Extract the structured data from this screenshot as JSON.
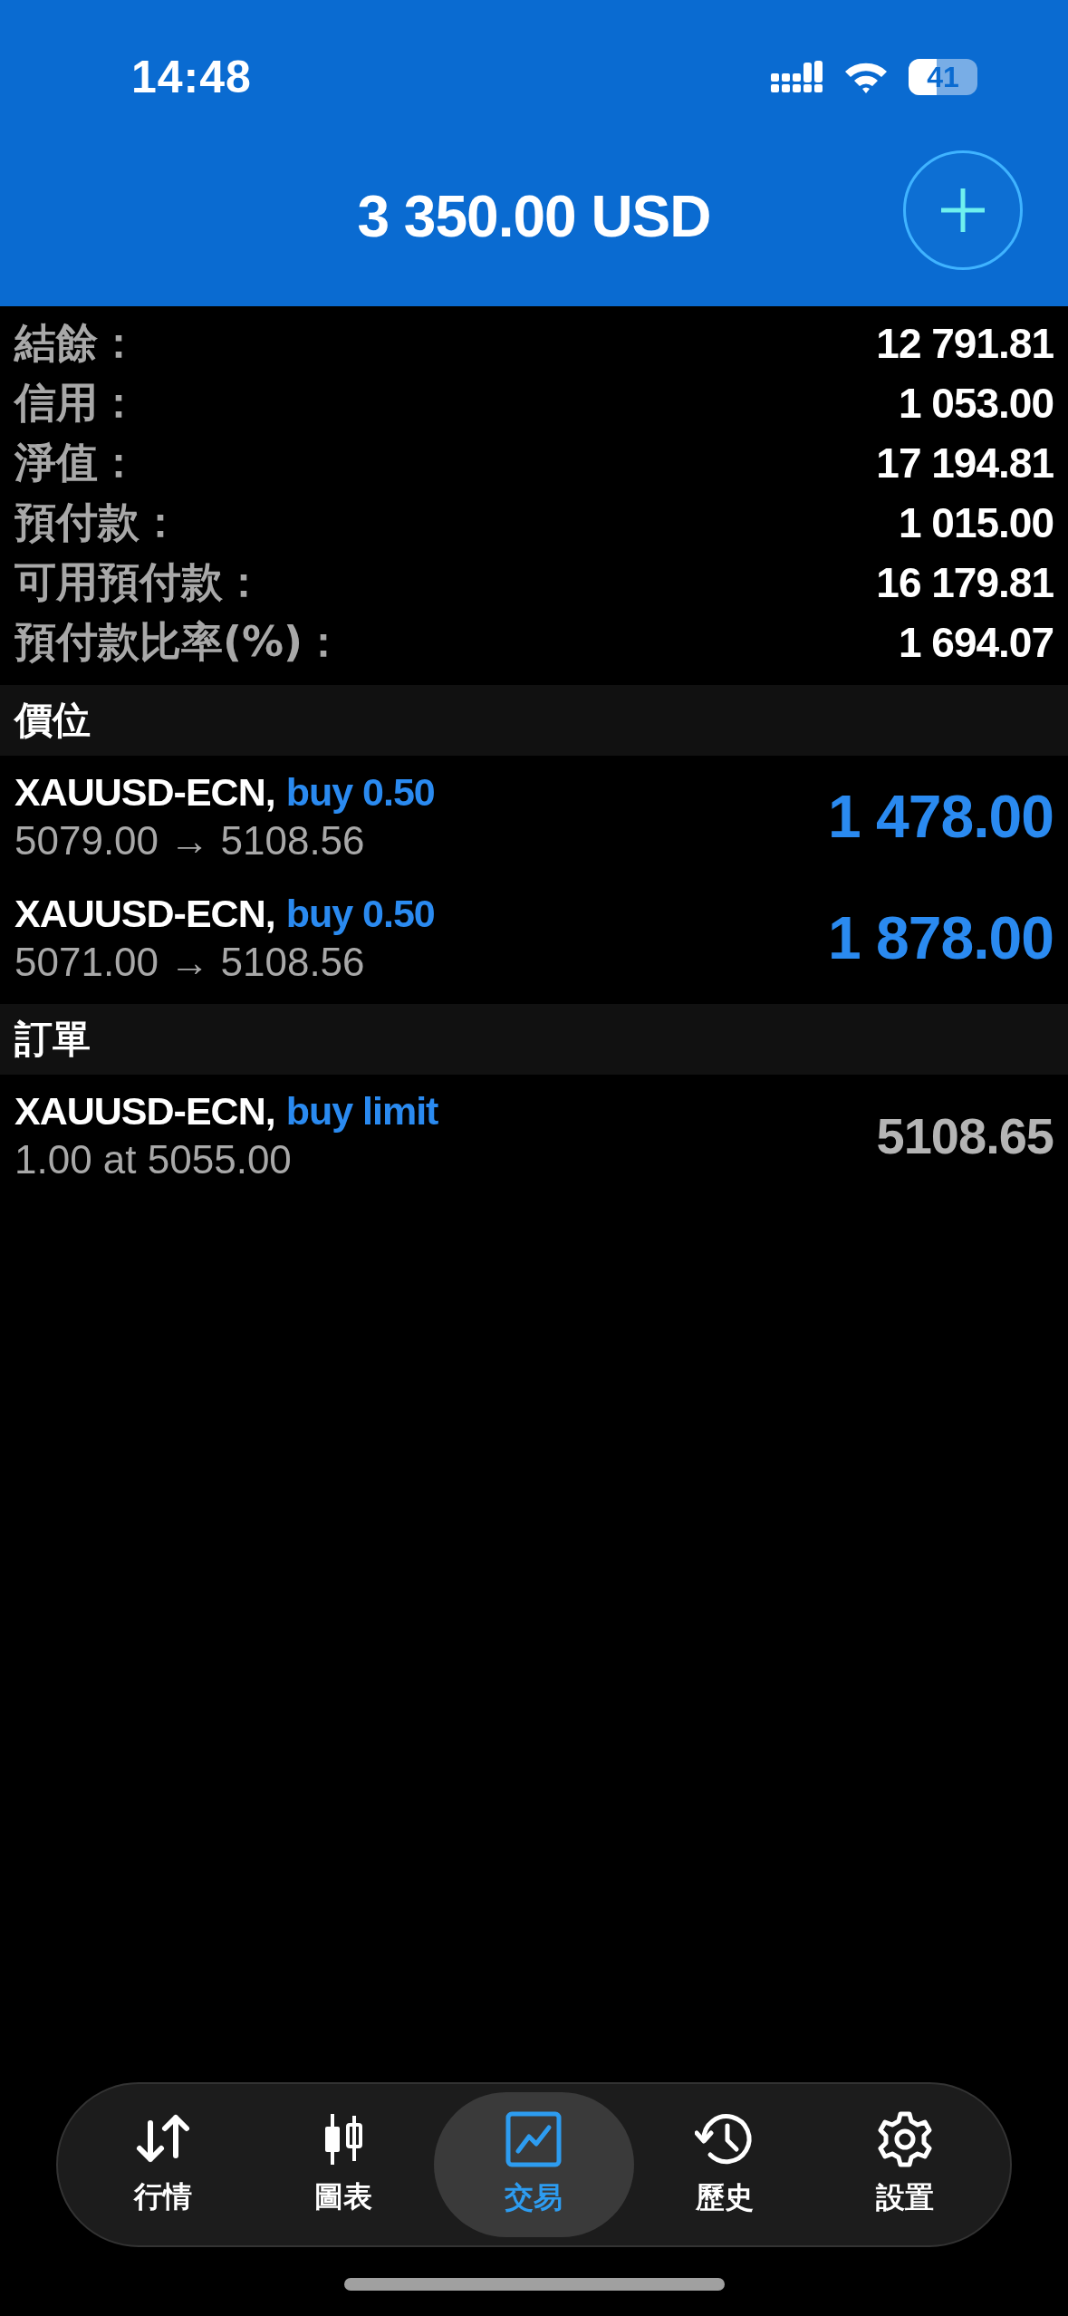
{
  "status_bar": {
    "time": "14:48",
    "battery": "41"
  },
  "header": {
    "balance": "3 350.00 USD"
  },
  "summary": [
    {
      "label": "結餘：",
      "value": "12 791.81"
    },
    {
      "label": "信用：",
      "value": "1 053.00"
    },
    {
      "label": "淨值：",
      "value": "17 194.81"
    },
    {
      "label": "預付款：",
      "value": "1 015.00"
    },
    {
      "label": "可用預付款：",
      "value": "16 179.81"
    },
    {
      "label": "預付款比率(%)：",
      "value": "1 694.07"
    }
  ],
  "positions": {
    "title": "價位",
    "items": [
      {
        "symbol": "XAUUSD-ECN,",
        "side": "buy 0.50",
        "prices": "5079.00 → 5108.56",
        "profit": "1 478.00"
      },
      {
        "symbol": "XAUUSD-ECN,",
        "side": "buy 0.50",
        "prices": "5071.00 → 5108.56",
        "profit": "1 878.00"
      }
    ]
  },
  "orders": {
    "title": "訂單",
    "items": [
      {
        "symbol": "XAUUSD-ECN,",
        "side": "buy limit",
        "detail": "1.00 at 5055.00",
        "price": "5108.65"
      }
    ]
  },
  "tabs": [
    {
      "kind": "quotes",
      "label": "行情",
      "selected": false
    },
    {
      "kind": "chart",
      "label": "圖表",
      "selected": false
    },
    {
      "kind": "trade",
      "label": "交易",
      "selected": true
    },
    {
      "kind": "history",
      "label": "歷史",
      "selected": false
    },
    {
      "kind": "settings",
      "label": "設置",
      "selected": false
    }
  ]
}
